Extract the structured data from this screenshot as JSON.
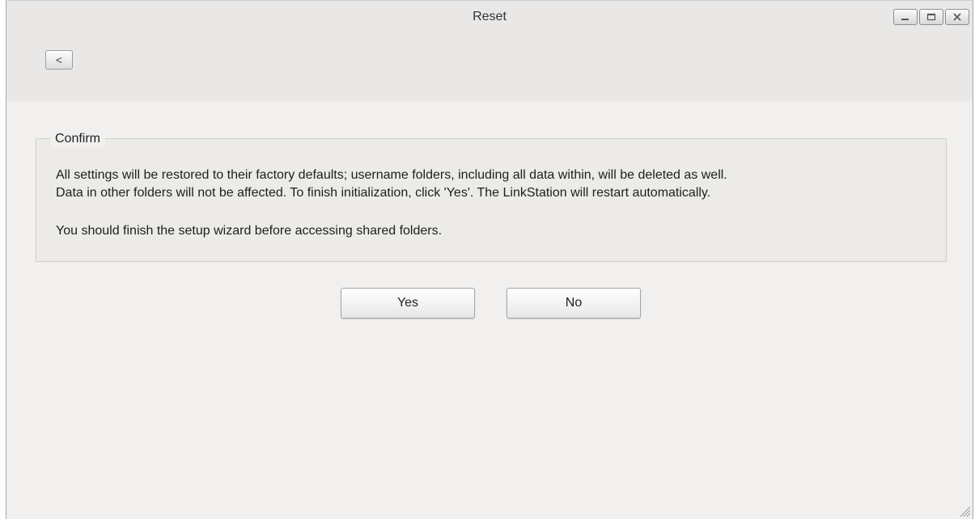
{
  "window": {
    "title": "Reset",
    "controls": {
      "minimize_icon": "minimize-icon",
      "maximize_icon": "maximize-icon",
      "close_icon": "close-icon"
    }
  },
  "toolbar": {
    "back_label": "<"
  },
  "confirm": {
    "legend": "Confirm",
    "line1": "All settings will be restored to their factory defaults; username folders, including all data within, will be deleted as well.",
    "line2": "Data in other folders will not be affected. To finish initialization, click 'Yes'. The LinkStation will restart automatically.",
    "line3": "You should finish the setup wizard before accessing shared folders."
  },
  "actions": {
    "yes_label": "Yes",
    "no_label": "No"
  },
  "colors": {
    "window_bg": "#f1f0ef",
    "header_bg": "#e9e8e6",
    "panel_bg": "#ecebe8",
    "text": "#1e1e1e"
  }
}
